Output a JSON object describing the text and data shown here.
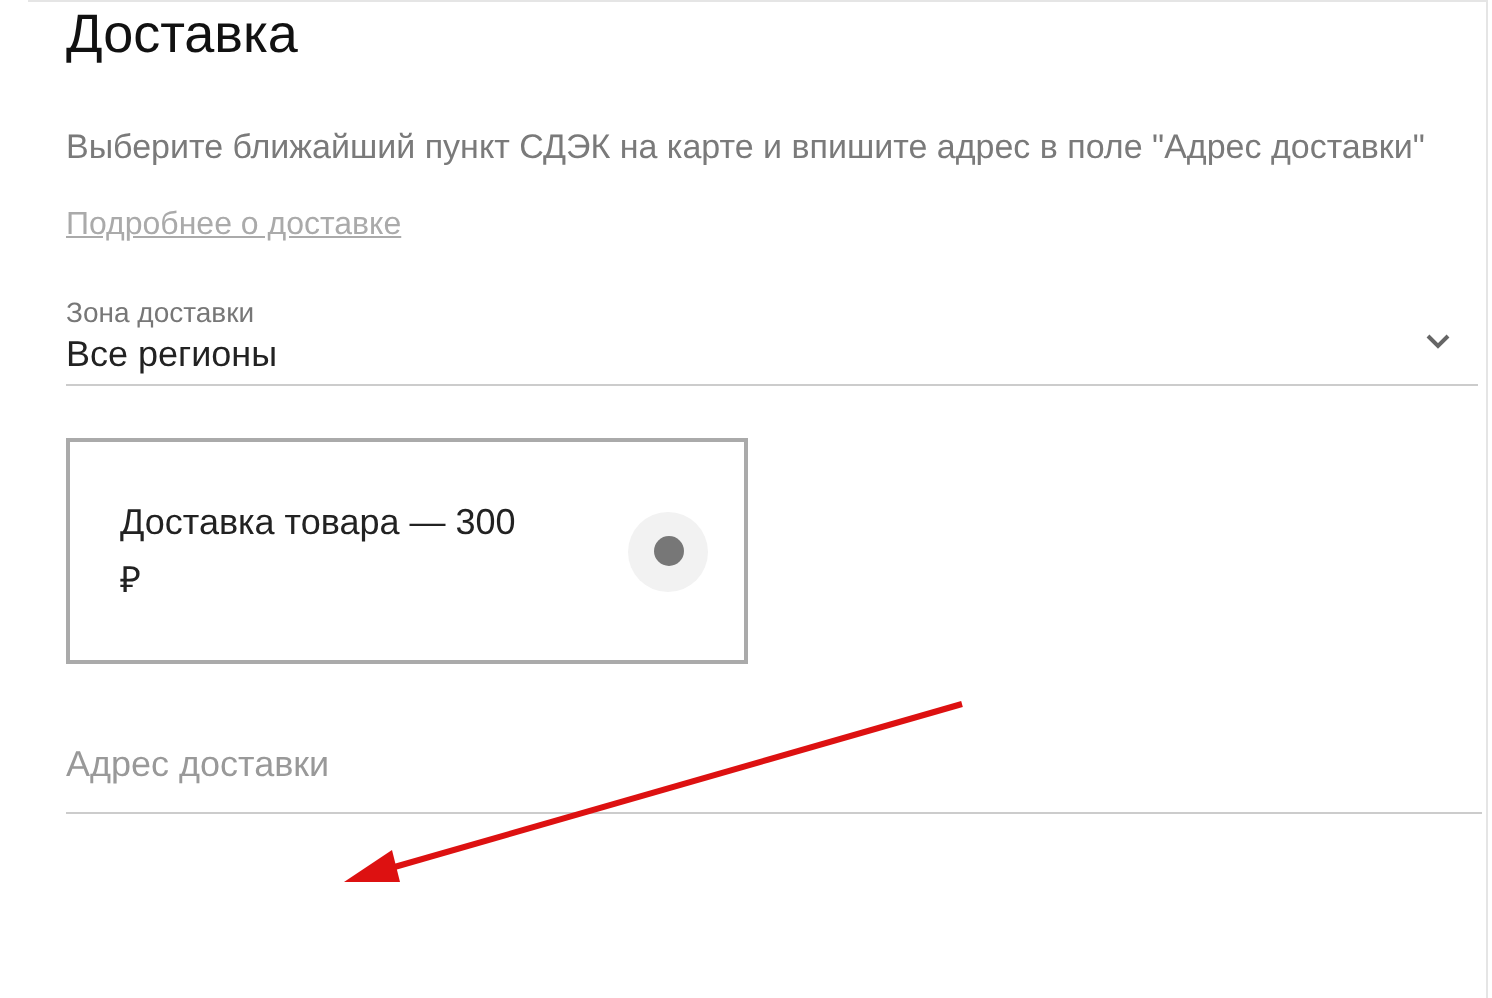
{
  "title": "Доставка",
  "description": "Выберите ближайший пункт СДЭК на карте и впишите адрес в поле \"Адрес доставки\"",
  "details_link": "Подробнее о доставке",
  "zone_select": {
    "label": "Зона доставки",
    "value": "Все регионы"
  },
  "options": [
    {
      "label": "Доставка товара — 300 ₽",
      "selected": true
    }
  ],
  "address_field": {
    "placeholder": "Адрес доставки"
  }
}
